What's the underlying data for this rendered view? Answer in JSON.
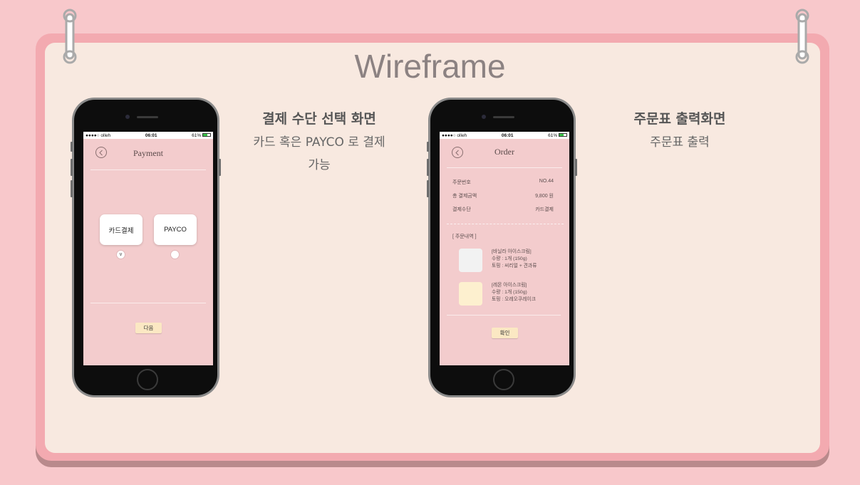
{
  "slide": {
    "title": "Wireframe",
    "colors": {
      "background": "#f8c8cb",
      "board": "#f8e9e0",
      "board_frame": "#f3aab0",
      "screen": "#f3cccd",
      "button": "#fbe8c3"
    }
  },
  "status_bar": {
    "carrier": "●●●●○ olleh",
    "time": "06:01",
    "battery": "61%"
  },
  "payment_screen": {
    "nav_title": "Payment",
    "options": [
      {
        "label": "카드결제",
        "selected": true,
        "mark": "v"
      },
      {
        "label": "PAYCO",
        "selected": false,
        "mark": ""
      }
    ],
    "next_button": "다음"
  },
  "payment_caption": {
    "title": "결제 수단 선택 화면",
    "line1": "카드 혹은 PAYCO 로 결제",
    "line2": "가능"
  },
  "order_screen": {
    "nav_title": "Order",
    "rows": [
      {
        "label": "주문번호",
        "value": "NO.44"
      },
      {
        "label": "총 결제금액",
        "value": "9,800 원"
      },
      {
        "label": "결제수단",
        "value": "카드결제"
      }
    ],
    "section_label": "[ 주문내역 ]",
    "items": [
      {
        "name": "[바닐라 아이스크림]",
        "qty": "수량 : 1개 (150g)",
        "topping": "토핑 : 씨리얼 + 견과류",
        "thumb_color": "#f2f2f2"
      },
      {
        "name": "[레몬 아이스크림]",
        "qty": "수량 : 1개 (150g)",
        "topping": "토핑 : 오레오쿠레이크",
        "thumb_color": "#fdf0cf"
      }
    ],
    "confirm_button": "확인"
  },
  "order_caption": {
    "title": "주문표 출력화면",
    "line1": "주문표 출력"
  }
}
